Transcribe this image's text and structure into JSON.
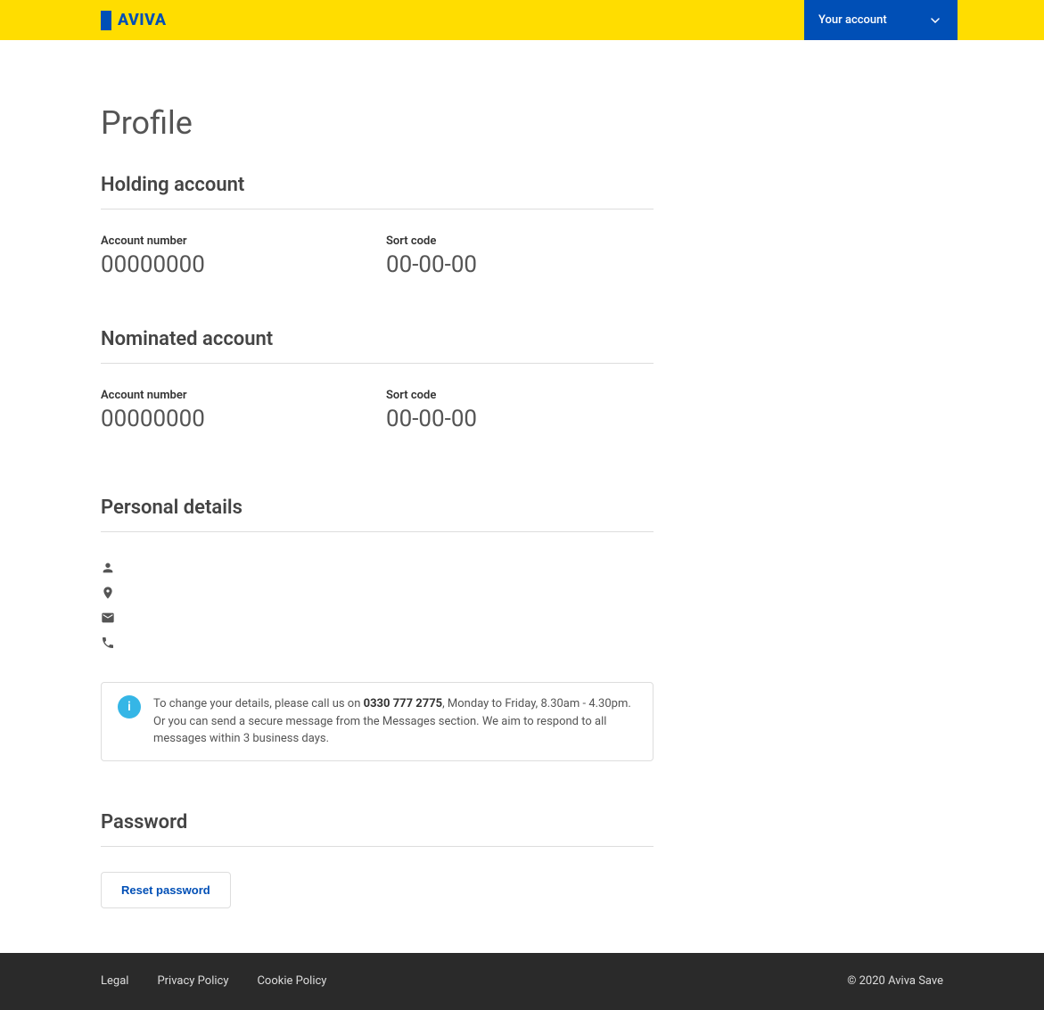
{
  "header": {
    "logo_text": "AVIVA",
    "account_label": "Your account"
  },
  "page": {
    "title": "Profile"
  },
  "holding": {
    "title": "Holding account",
    "account_number_label": "Account number",
    "account_number": "00000000",
    "sort_code_label": "Sort code",
    "sort_code": "00-00-00"
  },
  "nominated": {
    "title": "Nominated account",
    "account_number_label": "Account number",
    "account_number": "00000000",
    "sort_code_label": "Sort code",
    "sort_code": "00-00-00"
  },
  "personal": {
    "title": "Personal details",
    "info_prefix": "To change your details, please call us on ",
    "info_phone": "0330 777 2775",
    "info_suffix": ", Monday to Friday, 8.30am - 4.30pm. Or you can send a secure message from the Messages section. We aim to respond to all messages within 3 business days."
  },
  "password": {
    "title": "Password",
    "button_label": "Reset password"
  },
  "footer": {
    "links": {
      "legal": "Legal",
      "privacy": "Privacy Policy",
      "cookie": "Cookie Policy"
    },
    "copyright": "© 2020 Aviva Save"
  }
}
